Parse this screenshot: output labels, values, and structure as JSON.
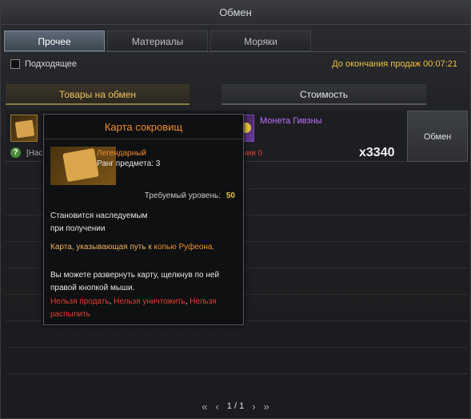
{
  "window": {
    "title": "Обмен"
  },
  "tabs": [
    {
      "label": "Прочее",
      "active": true
    },
    {
      "label": "Материалы",
      "active": false
    },
    {
      "label": "Моряки",
      "active": false
    }
  ],
  "filter": {
    "label": "Подходящее",
    "checked": false
  },
  "timer": "До окончания продаж 00:07:21",
  "columns": {
    "goods": "Товары на обмен",
    "cost": "Стоимость"
  },
  "row": {
    "badge": "?",
    "name": "[Нас",
    "cost_name": "Монета Гивзны",
    "owned": "личии 0",
    "quantity": "x3340",
    "exchange_label": "Обмен"
  },
  "tooltip": {
    "title": "Карта сокровищ",
    "grade": "Легендарный",
    "rank": "Ранг предмета: 3",
    "required_label": "Требуемый уровень:",
    "required_value": "50",
    "bind_line1": "Становится наследуемым",
    "bind_line2": "при получении",
    "lore_prefix": "Карта, указывающая путь к ",
    "lore_highlight": "копью Руфеона",
    "lore_suffix": ".",
    "usage": "Вы можете развернуть карту, щелкнув по ней правой кнопкой мыши.",
    "restrict_1": "Нельзя продать",
    "restrict_2": "Нельзя уничтожить",
    "restrict_3": "Нельзя распылить",
    "sep": ", "
  },
  "pager": {
    "first": "«",
    "prev": "‹",
    "page": "1 / 1",
    "next": "›",
    "last": "»"
  },
  "colors": {
    "legendary": "#f08c30",
    "accent_gold": "#f0c040",
    "red": "#e04030",
    "purple": "#c070ff"
  }
}
